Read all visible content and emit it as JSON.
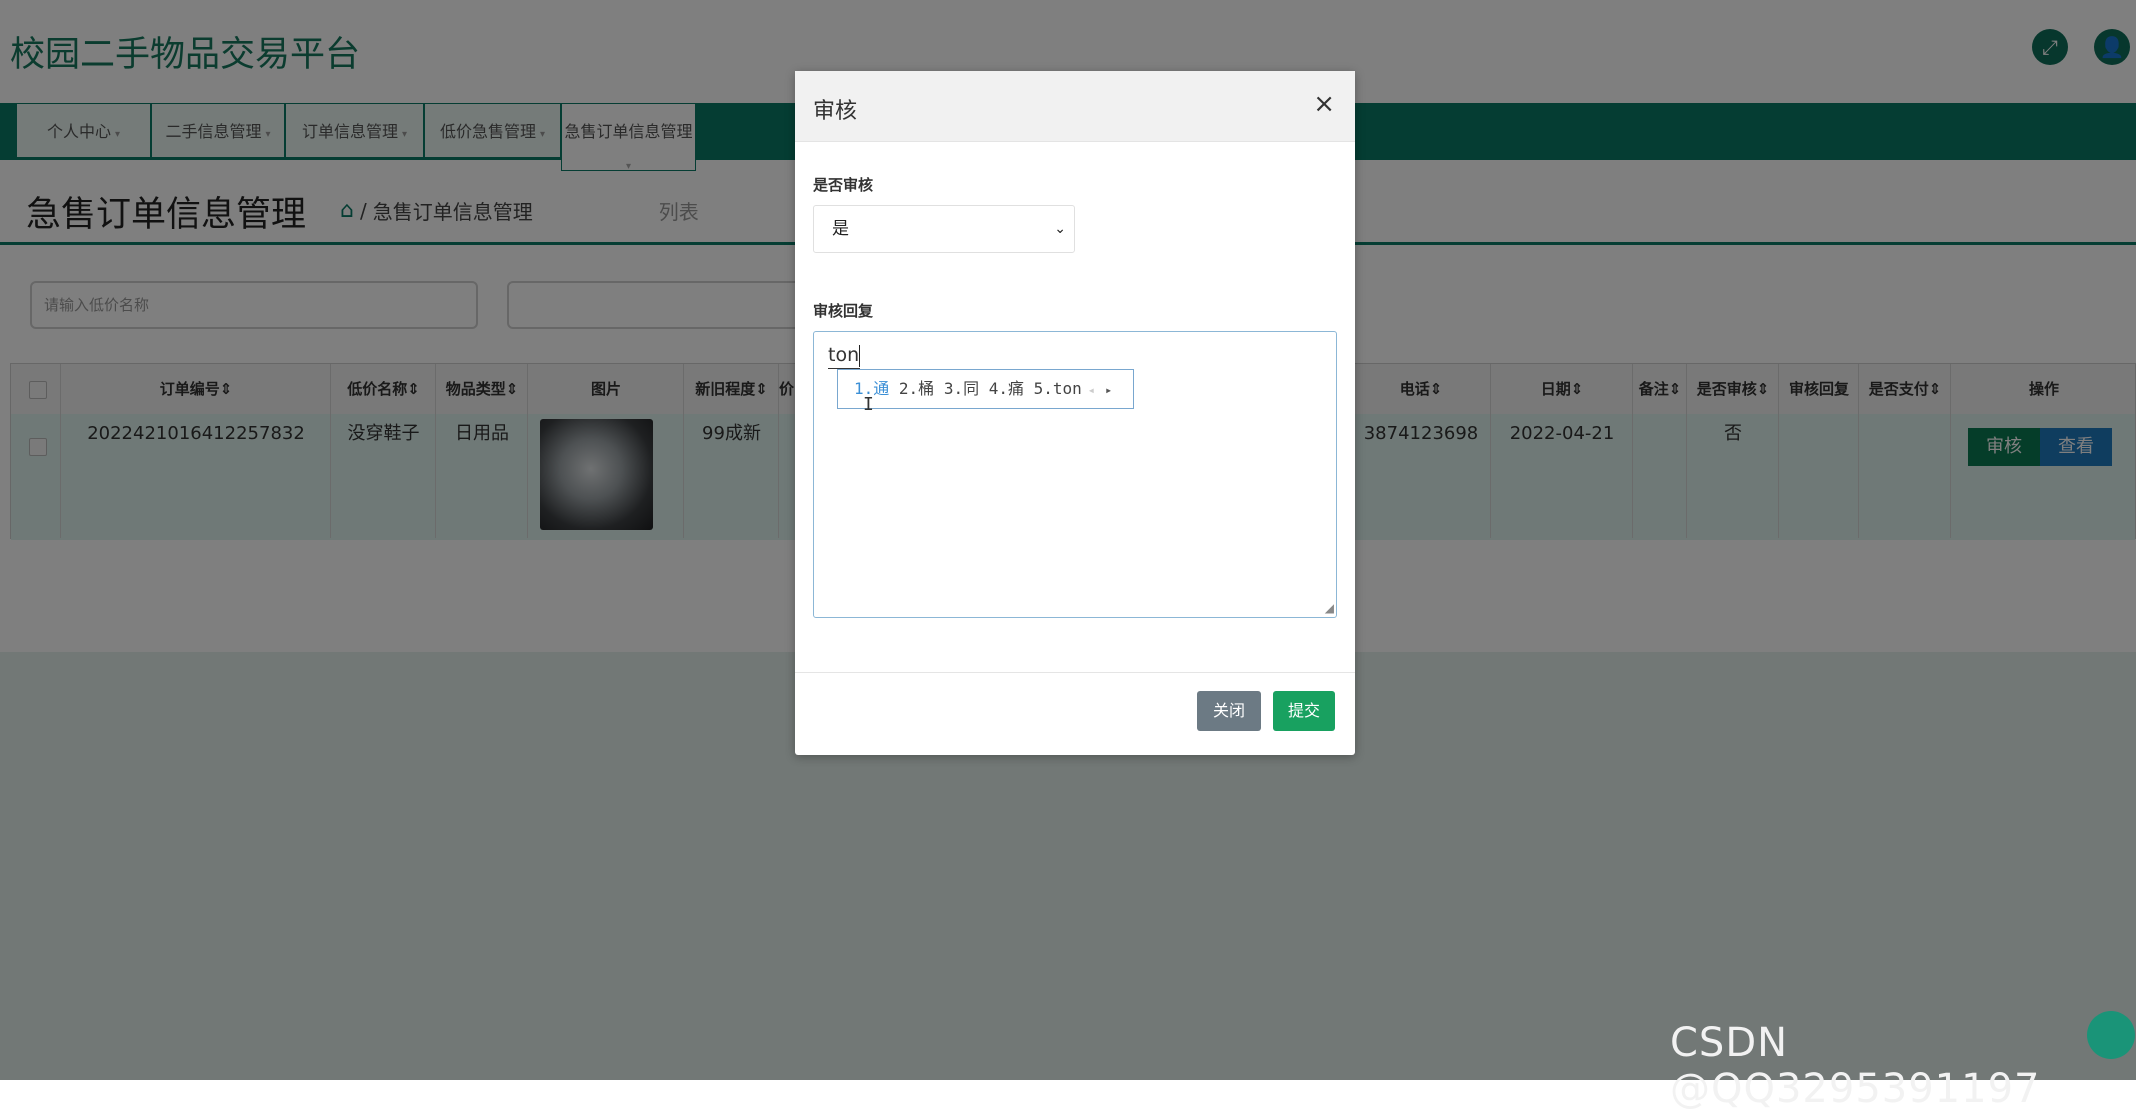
{
  "header": {
    "site_title": "校园二手物品交易平台",
    "icons": [
      "expand-icon",
      "user-icon"
    ]
  },
  "nav": {
    "items": [
      {
        "label": "个人中心"
      },
      {
        "label": "二手信息管理"
      },
      {
        "label": "订单信息管理"
      },
      {
        "label": "低价急售管理"
      },
      {
        "label": "急售订单信息管理"
      }
    ]
  },
  "page": {
    "title": "急售订单信息管理",
    "breadcrumb": {
      "sep": "/",
      "current": "急售订单信息管理",
      "tail": "列表"
    }
  },
  "search": {
    "placeholder": "请输入低价名称"
  },
  "table": {
    "columns": [
      "订单编号",
      "低价名称",
      "物品类型",
      "图片",
      "新旧程度",
      "电话",
      "日期",
      "备注",
      "是否审核",
      "审核回复",
      "是否支付",
      "操作"
    ],
    "row": {
      "order_no": "2022421016412257832",
      "name": "没穿鞋子",
      "type": "日用品",
      "condition": "99成新",
      "phone": "3874123698",
      "date": "2022-04-21",
      "note": "",
      "audited": "否",
      "reply": "",
      "paid": "",
      "actions": {
        "audit": "审核",
        "view": "查看"
      }
    },
    "partial_col_fragment": "价"
  },
  "modal": {
    "title": "审核",
    "close_glyph": "×",
    "field_audit_label": "是否审核",
    "field_audit_value": "是",
    "field_reply_label": "审核回复",
    "field_reply_value": "ton",
    "ime_candidates": "1.通 2.桶 3.同 4.痛 5.ton",
    "ime_first": "1.通",
    "ime_rest": " 2.桶 3.同 4.痛 5.ton",
    "buttons": {
      "close": "关闭",
      "submit": "提交"
    }
  },
  "colors": {
    "brand": "#0b7a66",
    "audit_button": "#0b7a52",
    "view_button": "#1f7bbf",
    "submit_button": "#18a160"
  },
  "watermark": "CSDN @QQ3295391197"
}
